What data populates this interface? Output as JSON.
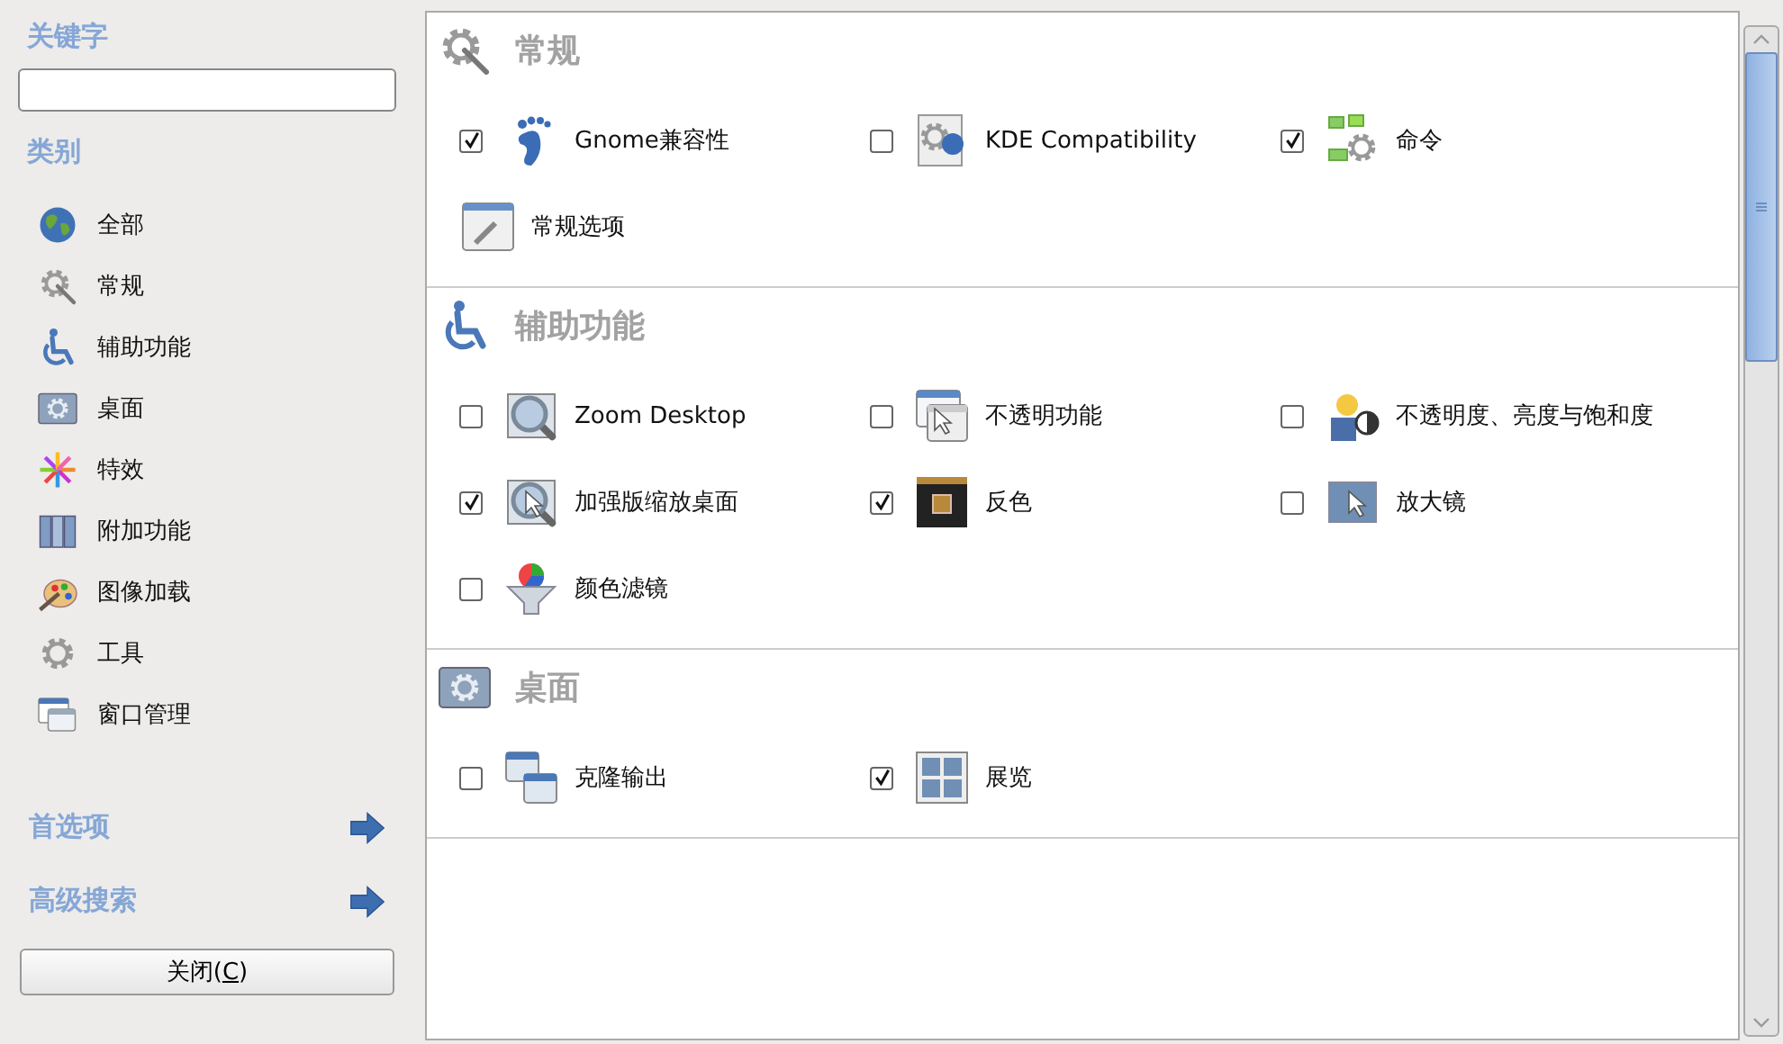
{
  "sidebar": {
    "keyword_label": "关键字",
    "category_label": "类别",
    "categories": [
      {
        "label": "全部"
      },
      {
        "label": "常规"
      },
      {
        "label": "辅助功能"
      },
      {
        "label": "桌面"
      },
      {
        "label": "特效"
      },
      {
        "label": "附加功能"
      },
      {
        "label": "图像加载"
      },
      {
        "label": "工具"
      },
      {
        "label": "窗口管理"
      }
    ],
    "links": [
      {
        "label": "首选项"
      },
      {
        "label": "高级搜索"
      }
    ],
    "close_button": {
      "label_before": "关闭(",
      "mnemonic": "C",
      "label_after": ")"
    }
  },
  "sections": [
    {
      "title": "常规",
      "items": [
        {
          "label": "Gnome兼容性",
          "kind": "toggle",
          "checked": true
        },
        {
          "label": "KDE Compatibility",
          "kind": "toggle",
          "checked": false
        },
        {
          "label": "命令",
          "kind": "toggle",
          "checked": true
        },
        {
          "label": "常规选项",
          "kind": "plain"
        }
      ]
    },
    {
      "title": "辅助功能",
      "items": [
        {
          "label": "Zoom Desktop",
          "kind": "toggle",
          "checked": false
        },
        {
          "label": "不透明功能",
          "kind": "toggle",
          "checked": false
        },
        {
          "label": "不透明度、亮度与饱和度",
          "kind": "toggle",
          "checked": false
        },
        {
          "label": "加强版缩放桌面",
          "kind": "toggle",
          "checked": true
        },
        {
          "label": "反色",
          "kind": "toggle",
          "checked": true
        },
        {
          "label": "放大镜",
          "kind": "toggle",
          "checked": false
        },
        {
          "label": "颜色滤镜",
          "kind": "toggle",
          "checked": false
        }
      ]
    },
    {
      "title": "桌面",
      "items": [
        {
          "label": "克隆输出",
          "kind": "toggle",
          "checked": false
        },
        {
          "label": "展览",
          "kind": "toggle",
          "checked": true
        }
      ]
    }
  ]
}
